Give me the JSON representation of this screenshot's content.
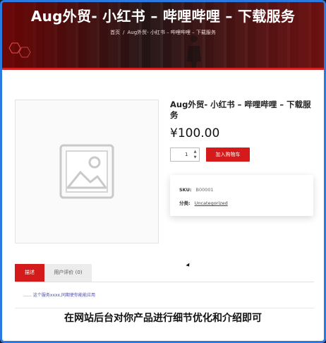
{
  "hero": {
    "title": "Aug外贸- 小红书 – 哔哩哔哩 – 下载服务",
    "breadcrumb": [
      "首页",
      "/",
      "Aug外贸- 小红书 – 哔哩哔哩 – 下载服务"
    ]
  },
  "product": {
    "title": "Aug外贸- 小红书 – 哔哩哔哩 – 下载服务",
    "price": "¥100.00",
    "quantity": "1",
    "add_to_cart": "加入购物车",
    "image_alt": "placeholder-image"
  },
  "meta": {
    "sku_label": "SKU:",
    "sku_value": "B00001",
    "category_label": "分类:",
    "category_value": "Uncategorized"
  },
  "tabs": {
    "description": "描述",
    "reviews": "用户评价 (0)"
  },
  "description_text": "…… 这个服务xxxx,同期使你能能应用",
  "subtitle": "在网站后台对你产品进行细节优化和介绍即可",
  "colors": {
    "accent": "#d41a1a",
    "frame": "#2a7ae2"
  }
}
